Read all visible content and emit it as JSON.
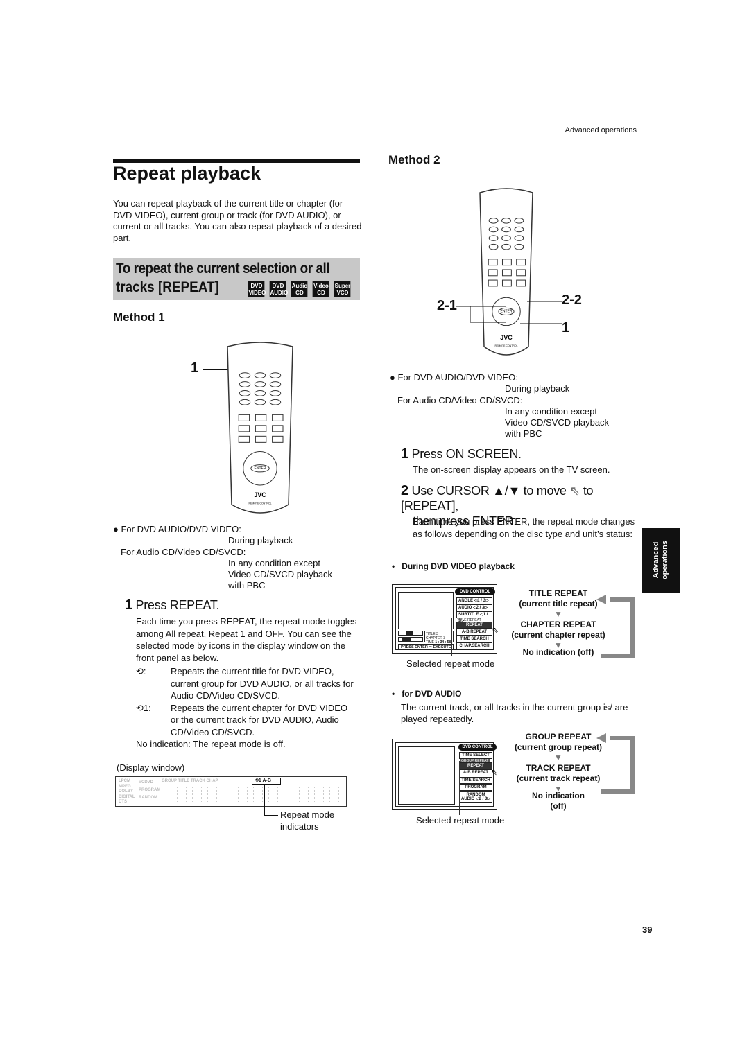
{
  "header": {
    "section": "Advanced operations"
  },
  "title": "Repeat playback",
  "intro": "You can repeat playback of the current title or chapter (for DVD VIDEO), current group or track (for DVD AUDIO), or current or all tracks. You can also repeat playback of a desired part.",
  "subsection": {
    "line1": "To repeat the current selection or all",
    "line2": "tracks [REPEAT]",
    "badges": [
      [
        "DVD",
        "VIDEO"
      ],
      [
        "DVD",
        "AUDIO"
      ],
      [
        "Audio",
        "CD"
      ],
      [
        "Video",
        "CD"
      ],
      [
        "Super",
        "VCD"
      ]
    ]
  },
  "method1": {
    "heading": "Method 1",
    "callout": "1",
    "conditions": {
      "a": "For DVD AUDIO/DVD VIDEO:",
      "a2": "During playback",
      "b": "For Audio CD/Video CD/SVCD:",
      "b2": "In any condition except",
      "b3": "Video CD/SVCD playback",
      "b4": "with PBC"
    },
    "step1": {
      "num": "1",
      "text": "Press REPEAT."
    },
    "para": "Each time you press REPEAT, the repeat mode toggles among All repeat, Repeat 1 and OFF. You can see the selected mode by icons in the display window on the front panel as below.",
    "icons": [
      {
        "icon": "repeat-all-icon",
        "label": ":",
        "text": "Repeats the current title for DVD VIDEO, current group for DVD AUDIO, or all tracks for Audio CD/Video CD/SVCD."
      },
      {
        "icon": "repeat-one-icon",
        "label": "1:",
        "text": "Repeats the current chapter for DVD VIDEO or the current track for DVD AUDIO, Audio CD/Video CD/SVCD."
      }
    ],
    "no_indication": "No indication: The repeat mode is off.",
    "display_label": "(Display window)",
    "display": {
      "left": [
        "LPCM",
        "MPEG",
        "DOLBY",
        "DIGITAL",
        "DTS"
      ],
      "mid": [
        "VCDVD",
        "PROGRAM",
        "RANDOM"
      ],
      "top": "GROUP TITLE TRACK CHAP",
      "indicator": "1  A-B"
    },
    "indicator_label": "Repeat mode indicators"
  },
  "method2": {
    "heading": "Method 2",
    "callouts": {
      "a": "2-1",
      "b": "2-2",
      "c": "1"
    },
    "conditions": {
      "a": "For DVD AUDIO/DVD VIDEO:",
      "a2": "During playback",
      "b": "For Audio CD/Video CD/SVCD:",
      "b2": "In any condition except",
      "b3": "Video CD/SVCD playback",
      "b4": "with PBC"
    },
    "step1": {
      "num": "1",
      "text": "Press ON SCREEN.",
      "desc": "The on-screen display appears on the TV screen."
    },
    "step2": {
      "num": "2",
      "text1": "Use CURSOR ▲/▼ to move",
      "text2": "to [REPEAT],",
      "text3": "then press ENTER.",
      "desc": "Each time you press ENTER, the repeat mode changes as follows depending on the disc type and unit’s status:"
    },
    "dvdvideo": {
      "heading": "During DVD VIDEO playback",
      "osd_title": "DVD CONTROL",
      "menu": [
        [
          "ANGLE",
          "1 / 3"
        ],
        [
          "AUDIO",
          "2 / 3"
        ],
        [
          "SUBTITLE",
          "1 / 3"
        ]
      ],
      "buttons": [
        "REPEAT",
        "A-B REPEAT",
        "TIME SEARCH",
        "CHAP.SEARCH"
      ],
      "selected_small": "TITLE REPEAT",
      "status": {
        "title": "TITLE",
        "title_v": "3",
        "chapter": "CHAPTER",
        "chapter_v": "3",
        "time": "TIME",
        "time_v": "1 : 34 : 58"
      },
      "footer": "PRESS ENTER ➡ EXECUTE",
      "caption": "Selected repeat mode",
      "flow": [
        [
          "TITLE REPEAT",
          "(current title repeat)"
        ],
        [
          "CHAPTER REPEAT",
          "(current chapter repeat)"
        ],
        [
          "No indication (off)",
          ""
        ]
      ]
    },
    "dvdaudio": {
      "heading": "for DVD AUDIO",
      "desc": "The current track, or all tracks in the current group is/ are played repeatedly.",
      "osd_title": "DVD CONTROL",
      "buttons": [
        "TIME SELECT",
        "REPEAT",
        "A-B REPEAT",
        "TIME SEARCH",
        "PROGRAM",
        "RANDOM"
      ],
      "audio": [
        "AUDIO",
        "2 / 3"
      ],
      "selected_small": "GROUP REPEAT",
      "caption": "Selected repeat mode",
      "flow": [
        [
          "GROUP REPEAT",
          "(current group repeat)"
        ],
        [
          "TRACK REPEAT",
          "(current track repeat)"
        ],
        [
          "No indication",
          "(off)"
        ]
      ]
    }
  },
  "side_tab": {
    "line1": "Advanced",
    "line2": "operations"
  },
  "remote": {
    "brand": "JVC",
    "sub": "REMOTE CONTROL",
    "enter": "ENTER"
  },
  "page_number": "39"
}
